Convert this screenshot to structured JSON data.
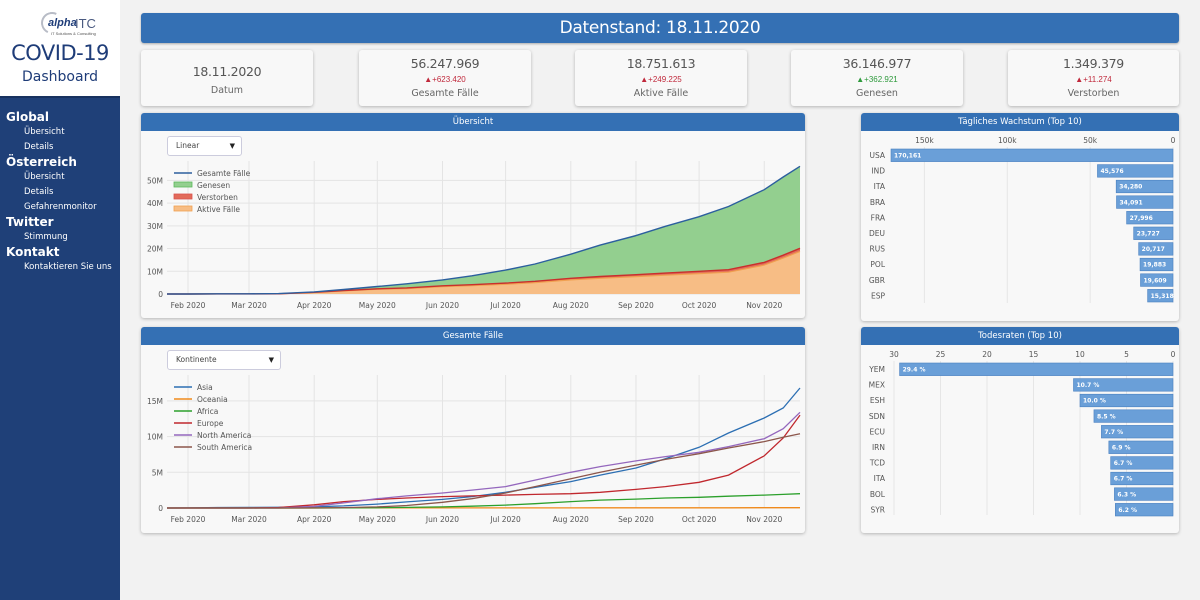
{
  "brand": {
    "logo_text": "alpha",
    "logo_suffix": "ITC",
    "logo_tagline": "IT Solutions & Consulting",
    "title": "COVID-19",
    "subtitle": "Dashboard"
  },
  "nav": [
    {
      "section": "Global",
      "items": [
        "Übersicht",
        "Details"
      ]
    },
    {
      "section": "Österreich",
      "items": [
        "Übersicht",
        "Details",
        "Gefahrenmonitor"
      ]
    },
    {
      "section": "Twitter",
      "items": [
        "Stimmung"
      ]
    },
    {
      "section": "Kontakt",
      "items": [
        "Kontaktieren Sie uns"
      ]
    }
  ],
  "header": {
    "title": "Datenstand: 18.11.2020"
  },
  "kpis": [
    {
      "value": "18.11.2020",
      "delta": "",
      "label": "Datum",
      "trend": ""
    },
    {
      "value": "56.247.969",
      "delta": "+623.420",
      "label": "Gesamte Fälle",
      "trend": "up-bad"
    },
    {
      "value": "18.751.613",
      "delta": "+249.225",
      "label": "Aktive Fälle",
      "trend": "up-bad"
    },
    {
      "value": "36.146.977",
      "delta": "+362.921",
      "label": "Genesen",
      "trend": "up-good"
    },
    {
      "value": "1.349.379",
      "delta": "+11.274",
      "label": "Verstorben",
      "trend": "up-bad"
    }
  ],
  "icons": {
    "triangle_up": "▲",
    "caret_down": "▼"
  },
  "colors": {
    "accent": "#3470b4",
    "sidebar": "#1f4078",
    "up_bad": "#c0283b",
    "up_good": "#2e9a3c",
    "bar": "#6a9fd8"
  },
  "overview": {
    "title": "Übersicht",
    "select_value": "Linear"
  },
  "totals": {
    "title": "Gesamte Fälle",
    "select_value": "Kontinente"
  },
  "growth": {
    "title": "Tägliches Wachstum (Top 10)"
  },
  "deathrates": {
    "title": "Todesraten (Top 10)"
  },
  "chart_data": [
    {
      "id": "overview",
      "type": "area",
      "title": "Übersicht",
      "x": [
        "Jan 22",
        "Feb 1",
        "Feb 15",
        "Mar 1",
        "Mar 15",
        "Apr 1",
        "Apr 15",
        "May 1",
        "May 15",
        "Jun 1",
        "Jun 15",
        "Jul 1",
        "Jul 15",
        "Aug 1",
        "Aug 15",
        "Sep 1",
        "Sep 15",
        "Oct 1",
        "Oct 15",
        "Nov 1",
        "Nov 10",
        "Nov 18"
      ],
      "xticks": [
        "Feb 2020",
        "Mar 2020",
        "Apr 2020",
        "May 2020",
        "Jun 2020",
        "Jul 2020",
        "Aug 2020",
        "Sep 2020",
        "Oct 2020",
        "Nov 2020"
      ],
      "yticks": [
        "0",
        "10M",
        "20M",
        "30M",
        "40M",
        "50M"
      ],
      "ylim": [
        0,
        55000000
      ],
      "legend_position": "top-left",
      "series": [
        {
          "name": "Gesamte Fälle",
          "color": "#2c5f9e",
          "values": [
            0.0006,
            0.012,
            0.07,
            0.09,
            0.17,
            0.93,
            2.0,
            3.3,
            4.5,
            6.2,
            8.0,
            10.5,
            13.2,
            17.5,
            21.5,
            25.7,
            29.8,
            34.0,
            38.5,
            45.9,
            51.5,
            56.2
          ]
        },
        {
          "name": "Genesen",
          "color": "#5cb85c",
          "values": [
            3e-05,
            0.0003,
            0.01,
            0.04,
            0.08,
            0.2,
            0.5,
            1.0,
            1.8,
            2.6,
            3.9,
            5.7,
            7.6,
            10.6,
            13.8,
            17.2,
            20.6,
            24.0,
            27.8,
            32.0,
            34.4,
            36.1
          ]
        },
        {
          "name": "Verstorben",
          "color": "#d9534f",
          "values": [
            1e-05,
            0.0003,
            0.001,
            0.003,
            0.006,
            0.05,
            0.13,
            0.23,
            0.31,
            0.38,
            0.44,
            0.52,
            0.58,
            0.69,
            0.78,
            0.86,
            0.94,
            1.03,
            1.1,
            1.2,
            1.28,
            1.35
          ]
        },
        {
          "name": "Aktive Fälle",
          "color": "#f0a050",
          "values": [
            0.0005,
            0.011,
            0.059,
            0.047,
            0.084,
            0.68,
            1.37,
            2.07,
            2.39,
            3.22,
            3.66,
            4.28,
            5.02,
            6.21,
            6.92,
            7.64,
            8.26,
            8.97,
            9.6,
            12.7,
            15.8,
            18.75
          ]
        }
      ],
      "units": "millions"
    },
    {
      "id": "totals",
      "type": "line",
      "title": "Gesamte Fälle",
      "x": [
        "Jan 22",
        "Feb 1",
        "Feb 15",
        "Mar 1",
        "Mar 15",
        "Apr 1",
        "Apr 15",
        "May 1",
        "May 15",
        "Jun 1",
        "Jun 15",
        "Jul 1",
        "Jul 15",
        "Aug 1",
        "Aug 15",
        "Sep 1",
        "Sep 15",
        "Oct 1",
        "Oct 15",
        "Nov 1",
        "Nov 10",
        "Nov 18"
      ],
      "xticks": [
        "Feb 2020",
        "Mar 2020",
        "Apr 2020",
        "May 2020",
        "Jun 2020",
        "Jul 2020",
        "Aug 2020",
        "Sep 2020",
        "Oct 2020",
        "Nov 2020"
      ],
      "yticks": [
        "0",
        "5M",
        "10M",
        "15M"
      ],
      "ylim": [
        0,
        17500000
      ],
      "legend_position": "top-left",
      "series": [
        {
          "name": "Asia",
          "color": "#2c6fb3",
          "values": [
            0.0006,
            0.012,
            0.07,
            0.085,
            0.1,
            0.17,
            0.3,
            0.55,
            0.85,
            1.2,
            1.6,
            2.2,
            2.9,
            3.7,
            4.6,
            5.6,
            6.9,
            8.5,
            10.5,
            12.6,
            14.0,
            16.8
          ]
        },
        {
          "name": "Oceania",
          "color": "#f08a1c",
          "values": [
            0,
            0,
            0,
            3e-05,
            0.0005,
            0.005,
            0.007,
            0.008,
            0.008,
            0.009,
            0.009,
            0.01,
            0.013,
            0.02,
            0.027,
            0.03,
            0.032,
            0.034,
            0.035,
            0.037,
            0.039,
            0.041
          ]
        },
        {
          "name": "Africa",
          "color": "#2ca02c",
          "values": [
            0,
            0,
            0,
            1e-05,
            0.0005,
            0.006,
            0.02,
            0.04,
            0.08,
            0.15,
            0.25,
            0.4,
            0.6,
            0.9,
            1.1,
            1.25,
            1.4,
            1.5,
            1.65,
            1.8,
            1.9,
            2.0
          ]
        },
        {
          "name": "Europe",
          "color": "#c0282e",
          "values": [
            0,
            2e-05,
            5e-05,
            0.002,
            0.07,
            0.45,
            0.9,
            1.2,
            1.4,
            1.6,
            1.7,
            1.8,
            1.9,
            2.0,
            2.2,
            2.6,
            3.0,
            3.6,
            4.6,
            7.3,
            9.8,
            13.0
          ]
        },
        {
          "name": "North America",
          "color": "#9467bd",
          "values": [
            0,
            1e-05,
            2e-05,
            0.0001,
            0.005,
            0.22,
            0.72,
            1.3,
            1.7,
            2.1,
            2.5,
            3.0,
            3.9,
            5.0,
            5.8,
            6.6,
            7.2,
            7.8,
            8.6,
            9.7,
            11.1,
            13.4
          ]
        },
        {
          "name": "South America",
          "color": "#8c564b",
          "values": [
            0,
            0,
            0,
            0,
            0.0008,
            0.01,
            0.05,
            0.15,
            0.35,
            0.8,
            1.3,
            2.1,
            3.0,
            4.1,
            5.0,
            6.0,
            6.8,
            7.6,
            8.4,
            9.3,
            9.9,
            10.4
          ]
        }
      ],
      "units": "millions"
    },
    {
      "id": "growth",
      "type": "bar",
      "orientation": "horizontal-reversed",
      "title": "Tägliches Wachstum (Top 10)",
      "categories": [
        "USA",
        "IND",
        "ITA",
        "BRA",
        "FRA",
        "DEU",
        "RUS",
        "POL",
        "GBR",
        "ESP"
      ],
      "values": [
        170161,
        45576,
        34280,
        34091,
        27996,
        23727,
        20717,
        19883,
        19609,
        15318
      ],
      "labels": [
        "170,161",
        "45,576",
        "34,280",
        "34,091",
        "27,996",
        "23,727",
        "20,717",
        "19,883",
        "19,609",
        "15,318"
      ],
      "xticks": [
        "150k",
        "100k",
        "50k",
        "0"
      ],
      "xtick_values": [
        150000,
        100000,
        50000,
        0
      ],
      "xlim": [
        0,
        170161
      ]
    },
    {
      "id": "deathrates",
      "type": "bar",
      "orientation": "horizontal-reversed",
      "title": "Todesraten (Top 10)",
      "categories": [
        "YEM",
        "MEX",
        "ESH",
        "SDN",
        "ECU",
        "IRN",
        "TCD",
        "ITA",
        "BOL",
        "SYR"
      ],
      "values": [
        29.4,
        10.7,
        10.0,
        8.5,
        7.7,
        6.9,
        6.7,
        6.7,
        6.3,
        6.2
      ],
      "labels": [
        "29.4 %",
        "10.7 %",
        "10.0 %",
        "8.5 %",
        "7.7 %",
        "6.9 %",
        "6.7 %",
        "6.7 %",
        "6.3 %",
        "6.2 %"
      ],
      "xticks": [
        "30",
        "25",
        "20",
        "15",
        "10",
        "5",
        "0"
      ],
      "xtick_values": [
        30,
        25,
        20,
        15,
        10,
        5,
        0
      ],
      "xlim": [
        0,
        30
      ]
    }
  ]
}
